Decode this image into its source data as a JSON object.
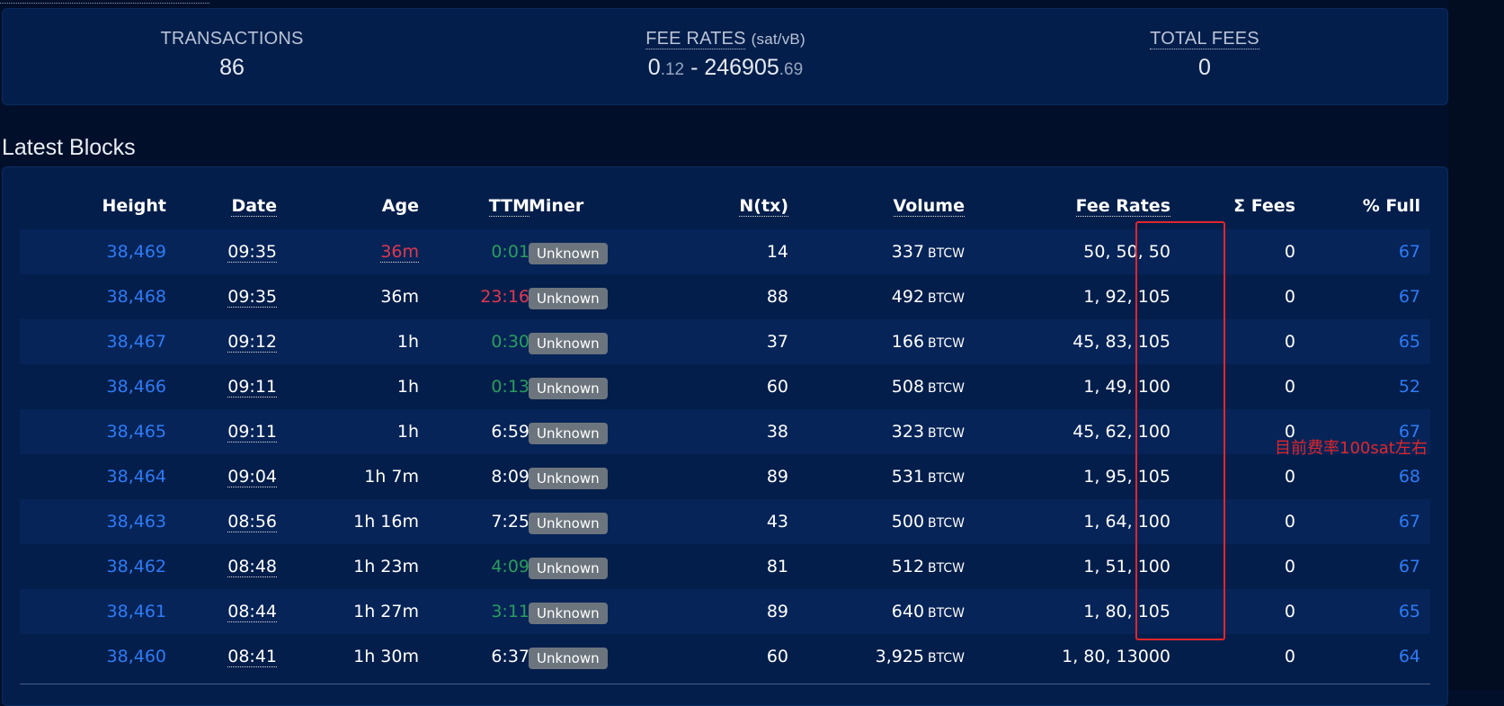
{
  "summary": {
    "transactions": {
      "label": "TRANSACTIONS",
      "value": "86"
    },
    "fee_rates": {
      "label": "FEE RATES",
      "unit": "(sat/vB)",
      "min_int": "0",
      "min_dec": ".12",
      "sep": " - ",
      "max_int": "246905",
      "max_dec": ".69"
    },
    "total_fees": {
      "label": "TOTAL FEES",
      "value": "0"
    }
  },
  "latest_blocks": {
    "title": "Latest Blocks",
    "columns": [
      "Height",
      "Date",
      "Age",
      "TTM",
      "Miner",
      "N(tx)",
      "Volume",
      "Fee Rates",
      "Σ Fees",
      "% Full"
    ],
    "volume_unit": "BTCW",
    "rows": [
      {
        "height": "38,469",
        "date": "09:35",
        "age": "36m",
        "age_status": "bad",
        "ttm": "0:01",
        "ttm_status": "good",
        "miner": "Unknown",
        "ntx": "14",
        "volume": "337",
        "fee_rates": "50, 50, 50",
        "fees": "0",
        "full": "67"
      },
      {
        "height": "38,468",
        "date": "09:35",
        "age": "36m",
        "age_status": "normal",
        "ttm": "23:16",
        "ttm_status": "bad",
        "miner": "Unknown",
        "ntx": "88",
        "volume": "492",
        "fee_rates": "1, 92, 105",
        "fees": "0",
        "full": "67"
      },
      {
        "height": "38,467",
        "date": "09:12",
        "age": "1h",
        "age_status": "normal",
        "ttm": "0:30",
        "ttm_status": "good",
        "miner": "Unknown",
        "ntx": "37",
        "volume": "166",
        "fee_rates": "45, 83, 105",
        "fees": "0",
        "full": "65"
      },
      {
        "height": "38,466",
        "date": "09:11",
        "age": "1h",
        "age_status": "normal",
        "ttm": "0:13",
        "ttm_status": "good",
        "miner": "Unknown",
        "ntx": "60",
        "volume": "508",
        "fee_rates": "1, 49, 100",
        "fees": "0",
        "full": "52"
      },
      {
        "height": "38,465",
        "date": "09:11",
        "age": "1h",
        "age_status": "normal",
        "ttm": "6:59",
        "ttm_status": "normal",
        "miner": "Unknown",
        "ntx": "38",
        "volume": "323",
        "fee_rates": "45, 62, 100",
        "fees": "0",
        "full": "67"
      },
      {
        "height": "38,464",
        "date": "09:04",
        "age": "1h 7m",
        "age_status": "normal",
        "ttm": "8:09",
        "ttm_status": "normal",
        "miner": "Unknown",
        "ntx": "89",
        "volume": "531",
        "fee_rates": "1, 95, 105",
        "fees": "0",
        "full": "68"
      },
      {
        "height": "38,463",
        "date": "08:56",
        "age": "1h 16m",
        "age_status": "normal",
        "ttm": "7:25",
        "ttm_status": "normal",
        "miner": "Unknown",
        "ntx": "43",
        "volume": "500",
        "fee_rates": "1, 64, 100",
        "fees": "0",
        "full": "67"
      },
      {
        "height": "38,462",
        "date": "08:48",
        "age": "1h 23m",
        "age_status": "normal",
        "ttm": "4:09",
        "ttm_status": "good",
        "miner": "Unknown",
        "ntx": "81",
        "volume": "512",
        "fee_rates": "1, 51, 100",
        "fees": "0",
        "full": "67"
      },
      {
        "height": "38,461",
        "date": "08:44",
        "age": "1h 27m",
        "age_status": "normal",
        "ttm": "3:11",
        "ttm_status": "good",
        "miner": "Unknown",
        "ntx": "89",
        "volume": "640",
        "fee_rates": "1, 80, 105",
        "fees": "0",
        "full": "65"
      },
      {
        "height": "38,460",
        "date": "08:41",
        "age": "1h 30m",
        "age_status": "normal",
        "ttm": "6:37",
        "ttm_status": "normal",
        "miner": "Unknown",
        "ntx": "60",
        "volume": "3,925",
        "fee_rates": "1, 80, 13000",
        "fees": "0",
        "full": "64"
      }
    ]
  },
  "annotation": {
    "text": "目前费率100sat左右",
    "color": "#e0262a"
  },
  "colors": {
    "link": "#2f7bf5",
    "bad": "#e0384f",
    "good": "#2a9d5c",
    "badge": "#6c757d",
    "background": "#020f2a",
    "card": "#041e4b"
  }
}
